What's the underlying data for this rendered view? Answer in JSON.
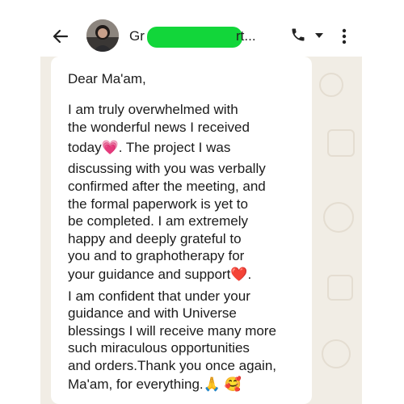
{
  "header": {
    "back_icon": "arrow-left-icon",
    "contact_name_prefix": "Gr",
    "contact_name_suffix": "rt...",
    "call_icon": "phone-icon",
    "dropdown_icon": "caret-down-icon",
    "menu_icon": "vertical-dots-icon"
  },
  "message": {
    "lines": [
      "Dear Ma'am,",
      "I am truly overwhelmed with",
      "the wonderful news I received",
      "today💗. The project I was",
      "discussing with you was verbally",
      "confirmed after the meeting, and",
      "the formal paperwork is yet to",
      "be completed. I am extremely",
      "happy and deeply grateful to",
      "you and to graphotherapy for",
      "your guidance and support❤️.",
      "I am confident that under your",
      "guidance and with Universe",
      "blessings I will receive many more",
      "such miraculous opportunities",
      "and orders.Thank you once again,",
      "Ma'am, for everything.🙏 🥰"
    ]
  },
  "colors": {
    "redaction": "#12d63a",
    "chat_background": "#f1ede5",
    "bubble": "#ffffff"
  }
}
